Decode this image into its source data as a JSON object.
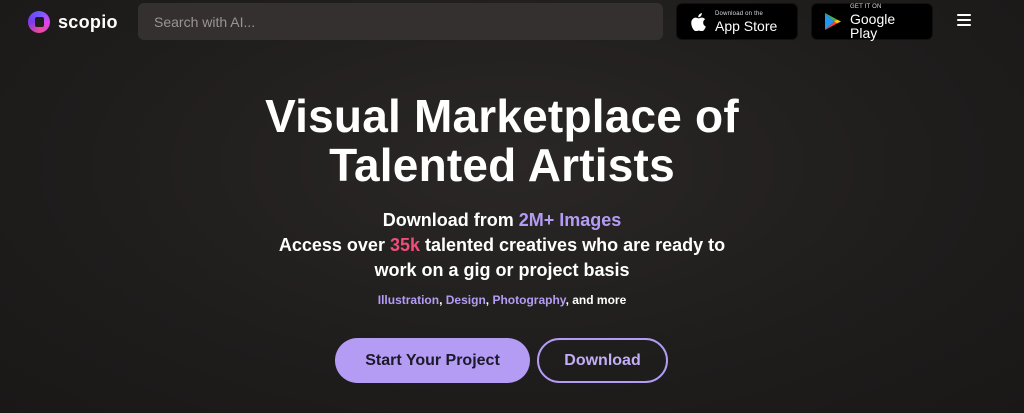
{
  "header": {
    "logo_text": "scopio",
    "search_placeholder": "Search with AI...",
    "app_store": {
      "small": "Download on the",
      "big": "App Store"
    },
    "google_play": {
      "small": "GET IT ON",
      "big": "Google Play"
    }
  },
  "hero": {
    "title_line1": "Visual Marketplace of",
    "title_line2": "Talented Artists",
    "sub1_prefix": "Download from ",
    "sub1_highlight": "2M+ Images",
    "sub2_prefix": "Access over ",
    "sub2_highlight": "35k",
    "sub2_suffix": " talented creatives who are ready to",
    "sub3": "work on a gig or project basis",
    "categories": [
      "Illustration",
      "Design",
      "Photography"
    ],
    "categories_sep": ", ",
    "categories_suffix": ", and more",
    "primary_button": "Start Your Project",
    "secondary_button": "Download"
  },
  "colors": {
    "accent_purple": "#b49cf5",
    "accent_pink": "#ef4d7a",
    "background": "#1f1d1c"
  },
  "icons": [
    "scopio-logo-icon",
    "apple-icon",
    "google-play-icon",
    "hamburger-menu-icon"
  ]
}
